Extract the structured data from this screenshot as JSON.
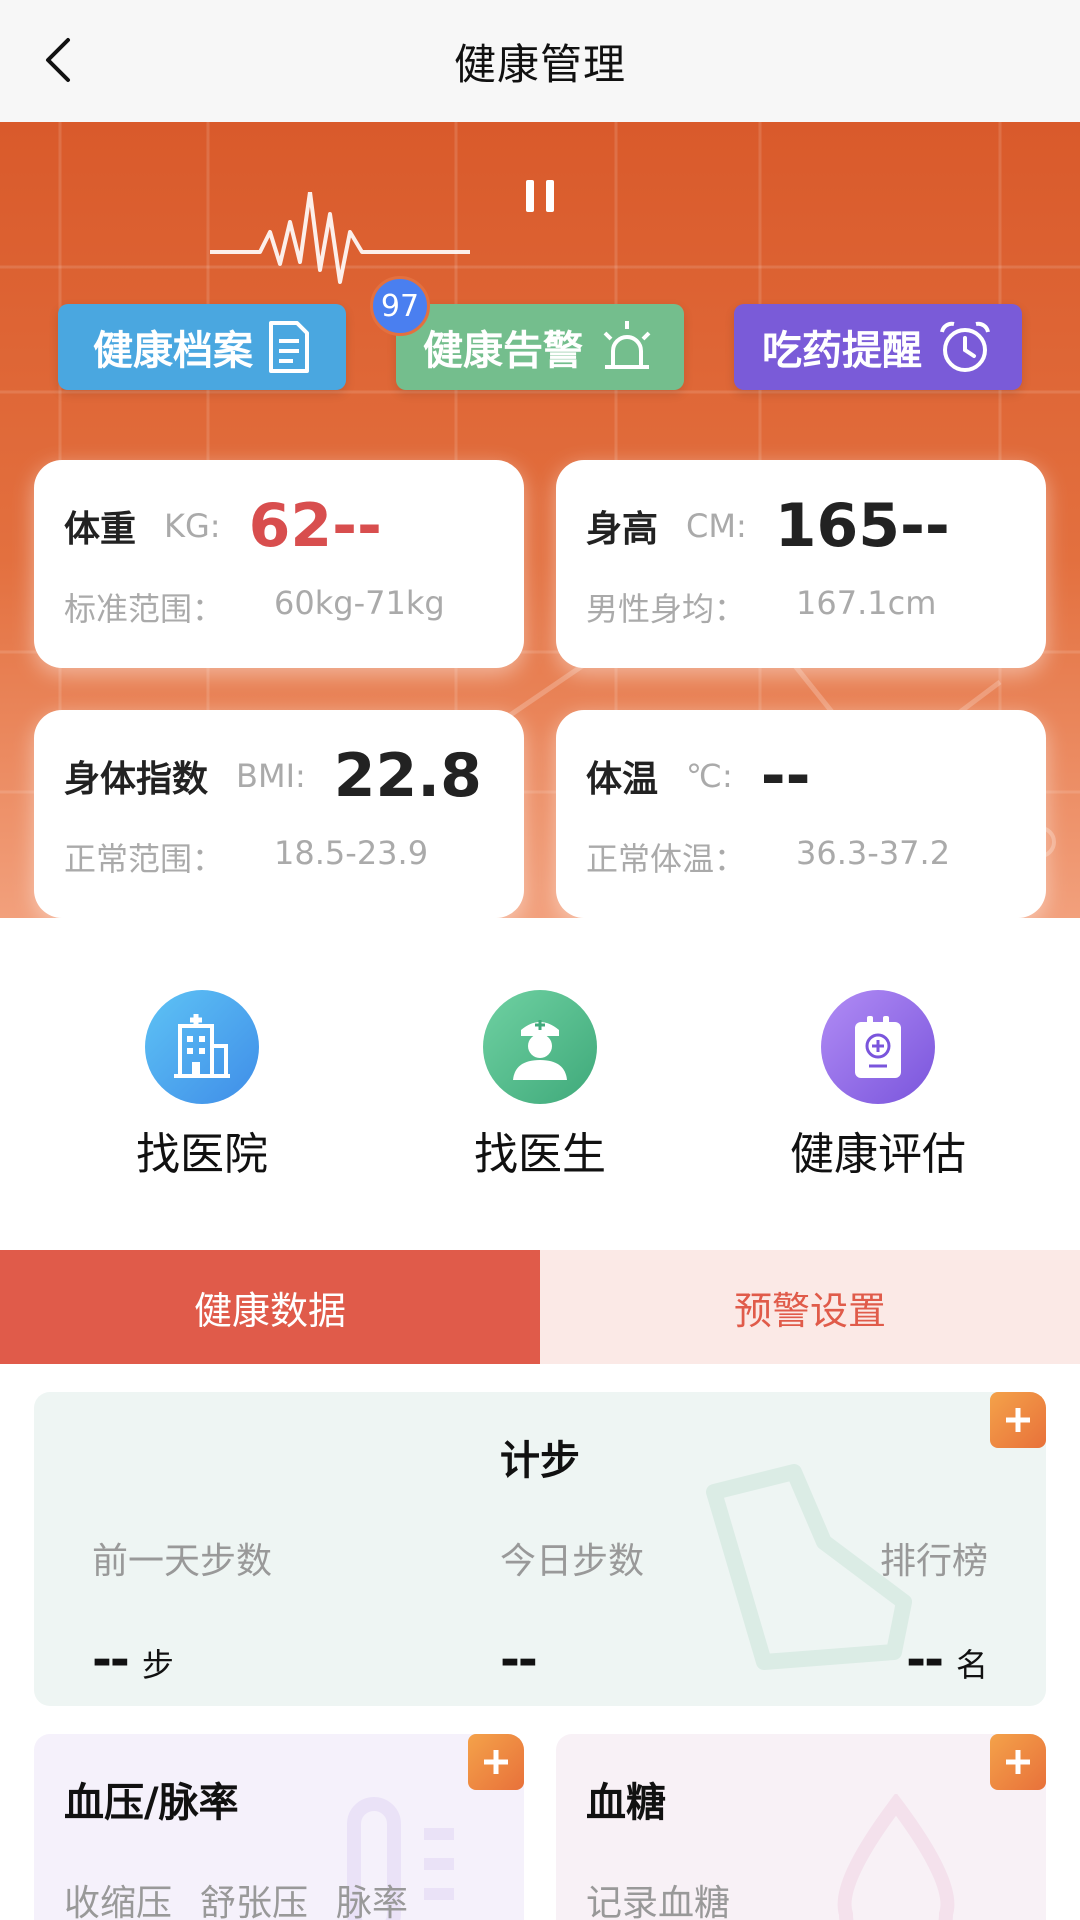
{
  "header": {
    "title": "健康管理",
    "back_icon": "chevron-left-icon"
  },
  "hero": {
    "badge_count": "97",
    "buttons": [
      {
        "label": "健康档案",
        "icon": "document-icon",
        "color": "#4aa7e0"
      },
      {
        "label": "健康告警",
        "icon": "alarm-light-icon",
        "color": "#74be8d"
      },
      {
        "label": "吃药提醒",
        "icon": "alarm-clock-icon",
        "color": "#7a5bd8"
      }
    ],
    "metrics": [
      {
        "name": "体重",
        "unit": "KG:",
        "value": "62--",
        "range_label": "标准范围：",
        "range_value": "60kg-71kg"
      },
      {
        "name": "身高",
        "unit": "CM:",
        "value": "165--",
        "range_label": "男性身均：",
        "range_value": "167.1cm"
      },
      {
        "name": "身体指数",
        "unit": "BMI:",
        "value": "22.8",
        "range_label": "正常范围：",
        "range_value": "18.5-23.9"
      },
      {
        "name": "体温",
        "unit": "℃:",
        "value": "--",
        "range_label": "正常体温：",
        "range_value": "36.3-37.2"
      }
    ]
  },
  "services": [
    {
      "label": "找医院",
      "icon": "hospital-icon"
    },
    {
      "label": "找医生",
      "icon": "doctor-icon"
    },
    {
      "label": "健康评估",
      "icon": "clipboard-plus-icon"
    }
  ],
  "tabs": [
    {
      "label": "健康数据",
      "active": true
    },
    {
      "label": "预警设置",
      "active": false
    }
  ],
  "steps": {
    "title": "计步",
    "columns": [
      {
        "label": "前一天步数",
        "value": "--",
        "unit": "步"
      },
      {
        "label": "今日步数",
        "value": "--",
        "unit": ""
      },
      {
        "label": "排行榜",
        "value": "--",
        "unit": "名"
      }
    ]
  },
  "blood_pressure": {
    "title": "血压/脉率",
    "labels": [
      "收缩压",
      "舒张压",
      "脉率"
    ]
  },
  "blood_sugar": {
    "title": "血糖",
    "labels": [
      "记录血糖"
    ]
  },
  "colors": {
    "accent": "#e05b4a",
    "hero": "#e3703f",
    "add": "#e8713a"
  }
}
